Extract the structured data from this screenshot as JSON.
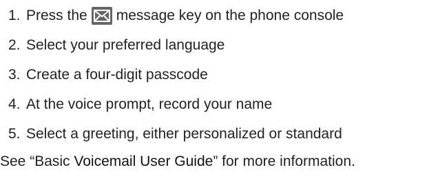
{
  "steps": [
    {
      "number": "1.",
      "text_before": "Press the",
      "icon": "envelope-message-icon",
      "text_after": "message key on the phone console"
    },
    {
      "number": "2.",
      "text": "Select your preferred language"
    },
    {
      "number": "3.",
      "text": "Create a four-digit passcode"
    },
    {
      "number": "4.",
      "text": "At the voice prompt, record your name"
    },
    {
      "number": "5.",
      "text": "Select a greeting, either personalized or standard"
    }
  ],
  "footer": {
    "prefix": "See “Basic ",
    "link_text": "Voicemail User Guide",
    "suffix": "” for more information."
  },
  "colors": {
    "text": "#222222",
    "icon_bg": "#666666",
    "icon_stroke": "#ffffff"
  }
}
